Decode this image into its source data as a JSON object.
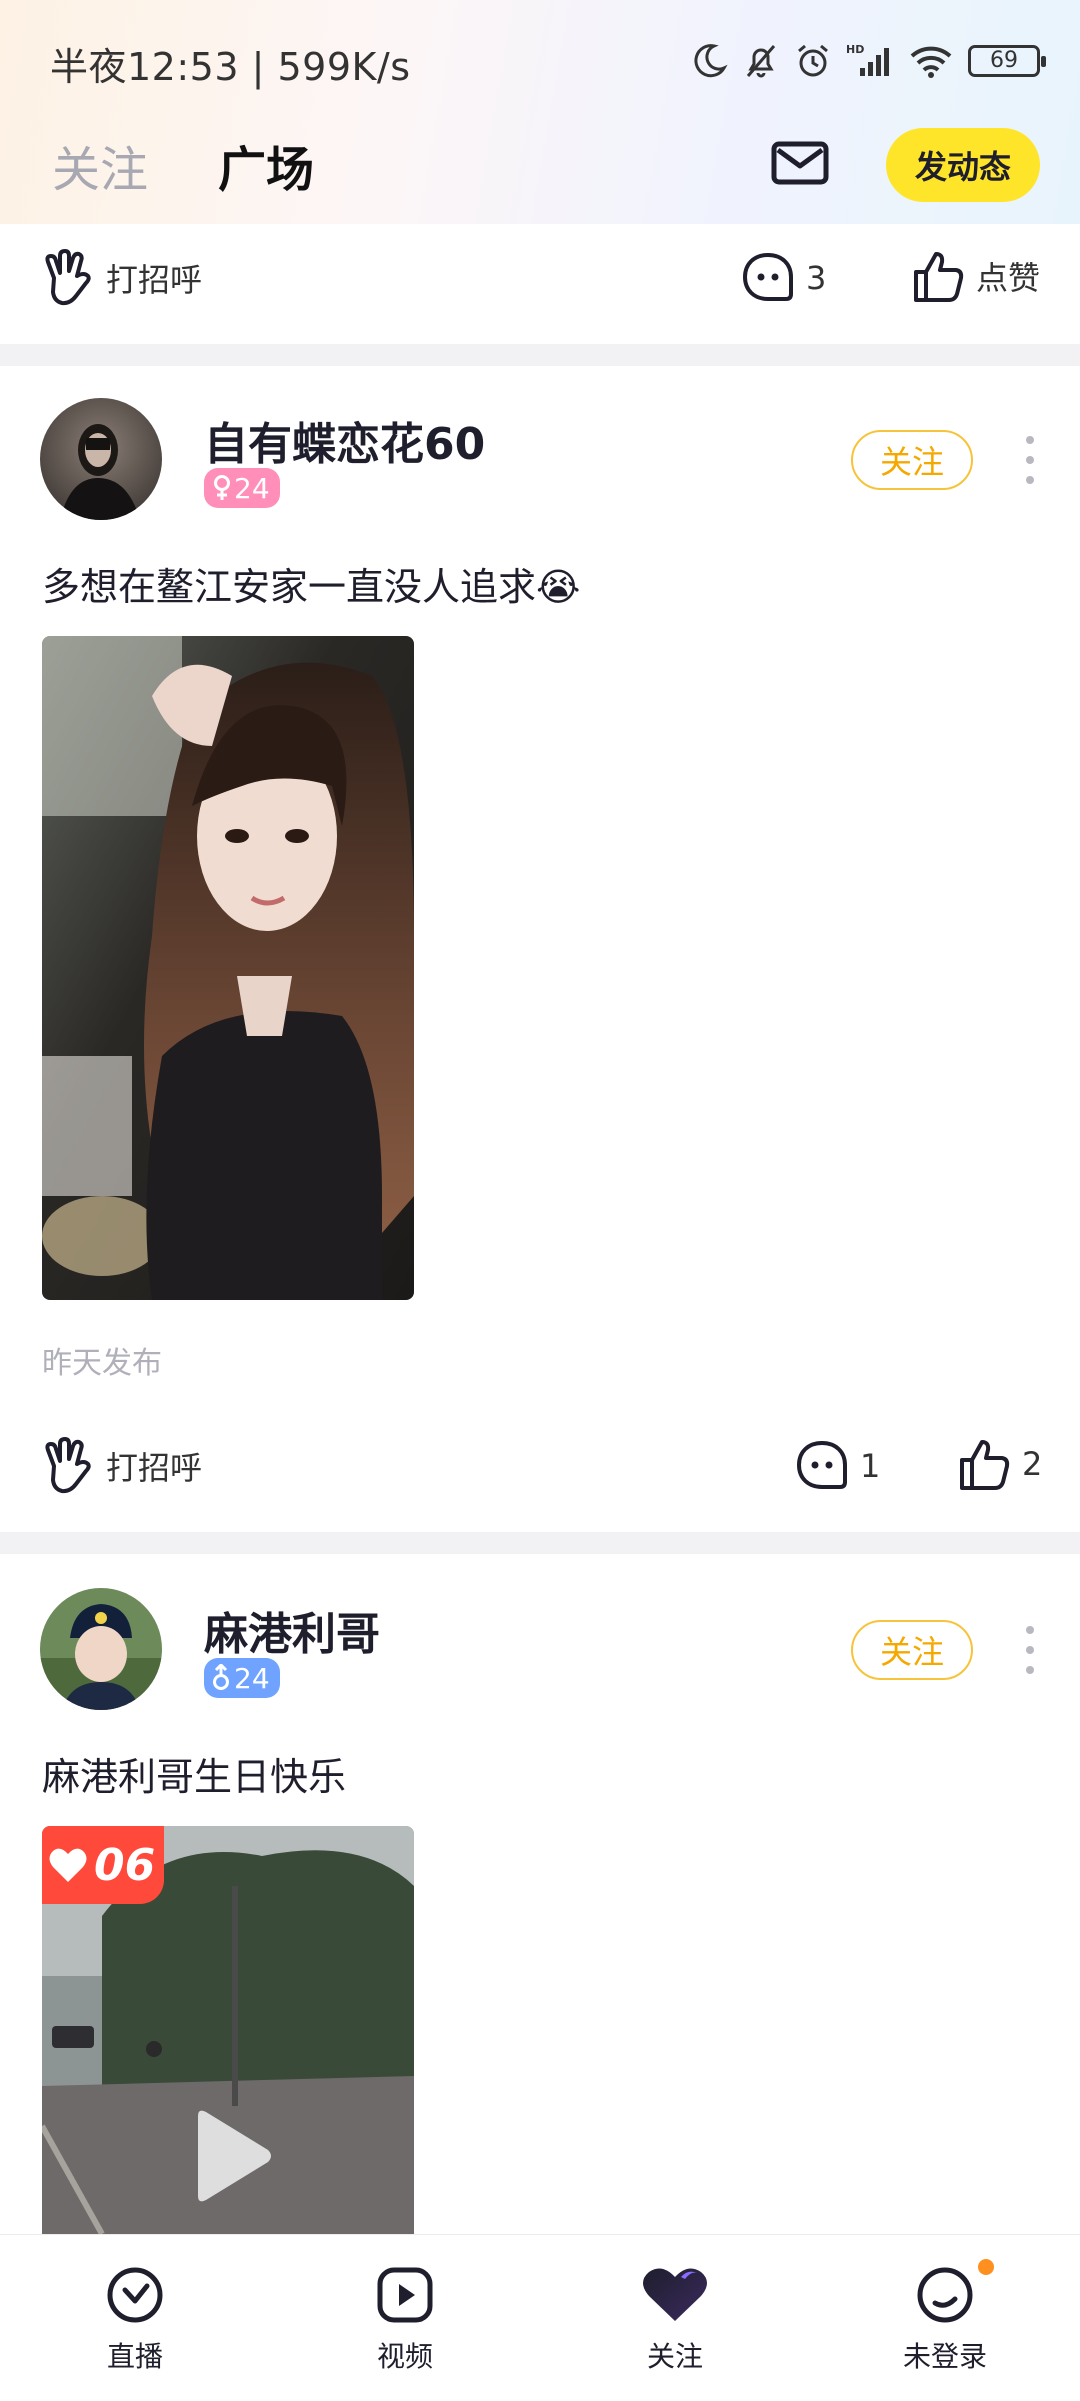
{
  "status_bar": {
    "time_speed": "半夜12:53 | 599K/s",
    "battery": "69"
  },
  "header": {
    "tabs": [
      "关注",
      "广场"
    ],
    "active_tab": "广场",
    "post_button": "发动态",
    "mail_icon": "mail-icon"
  },
  "feed": {
    "prev_post_actions": {
      "greet": "打招呼",
      "comments": "3",
      "like": "点赞"
    },
    "posts": [
      {
        "username": "自有蝶恋花60",
        "gender": "female",
        "age": "24",
        "follow": "关注",
        "text": "多想在鳌江安家一直没人追求😭",
        "time": "昨天发布",
        "greet": "打招呼",
        "comments": "1",
        "likes": "2"
      },
      {
        "username": "麻港利哥",
        "gender": "male",
        "age": "24",
        "follow": "关注",
        "text": "麻港利哥生日快乐",
        "video_badge": "06"
      }
    ]
  },
  "bottom_nav": [
    {
      "label": "直播",
      "icon": "live-icon"
    },
    {
      "label": "视频",
      "icon": "video-icon"
    },
    {
      "label": "关注",
      "icon": "heart-icon"
    },
    {
      "label": "未登录",
      "icon": "profile-icon"
    }
  ],
  "colors": {
    "accent_yellow": "#ffe52a",
    "follow_orange": "#f5a800",
    "female_pink": "#ff8fb9",
    "male_blue": "#6fa3ff"
  }
}
